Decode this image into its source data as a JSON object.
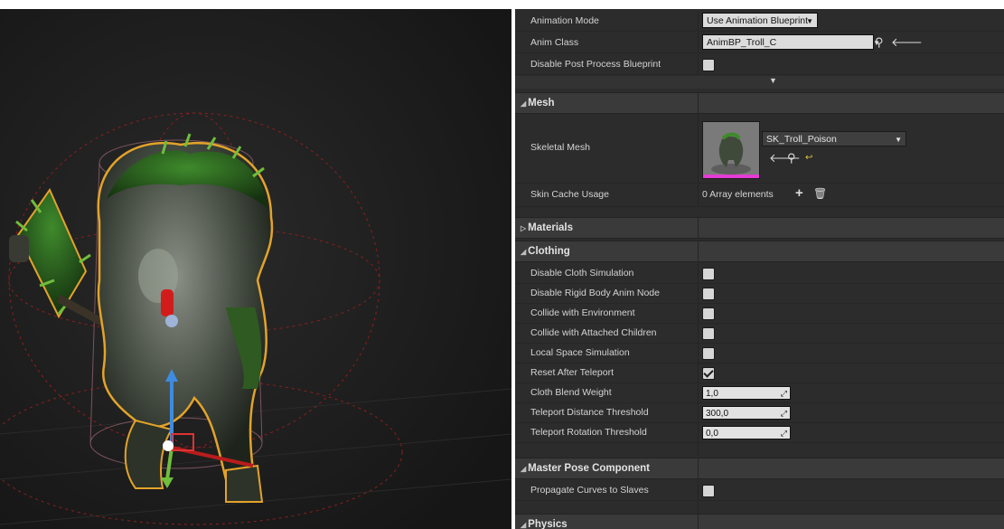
{
  "panel": {
    "animation_mode": {
      "label": "Animation Mode",
      "value": "Use Animation Blueprint"
    },
    "anim_class": {
      "label": "Anim Class",
      "value": "AnimBP_Troll_C"
    },
    "disable_post_process": {
      "label": "Disable Post Process Blueprint",
      "checked": false
    },
    "mesh": {
      "header": "Mesh",
      "skeletal_mesh_label": "Skeletal Mesh",
      "skeletal_mesh_value": "SK_Troll_Poison",
      "skin_cache_label": "Skin Cache Usage",
      "skin_cache_value": "0 Array elements"
    },
    "materials_header": "Materials",
    "clothing": {
      "header": "Clothing",
      "rows": [
        {
          "label": "Disable Cloth Simulation",
          "checked": false
        },
        {
          "label": "Disable Rigid Body Anim Node",
          "checked": false
        },
        {
          "label": "Collide with Environment",
          "checked": false
        },
        {
          "label": "Collide with Attached Children",
          "checked": false
        },
        {
          "label": "Local Space Simulation",
          "checked": false
        },
        {
          "label": "Reset After Teleport",
          "checked": true
        }
      ],
      "numeric": [
        {
          "label": "Cloth Blend Weight",
          "value": "1,0"
        },
        {
          "label": "Teleport Distance Threshold",
          "value": "300,0"
        },
        {
          "label": "Teleport Rotation Threshold",
          "value": "0,0"
        }
      ]
    },
    "master_pose": {
      "header": "Master Pose Component",
      "propagate_label": "Propagate Curves to Slaves",
      "propagate_checked": false
    },
    "physics_header": "Physics"
  },
  "icons": {
    "search": "search-icon",
    "use": "arrow-left-icon",
    "browse": "browse-icon",
    "add": "plus-icon",
    "delete": "trash-icon",
    "expand": "chevron-down-icon"
  },
  "colors": {
    "panel_bg": "#2c2c2c",
    "category_bg": "#3a3a3a",
    "viewport_bg": "#1d1d1d",
    "selection_outline": "#e3a32a",
    "thumbnail_bar": "#e43bd5"
  }
}
